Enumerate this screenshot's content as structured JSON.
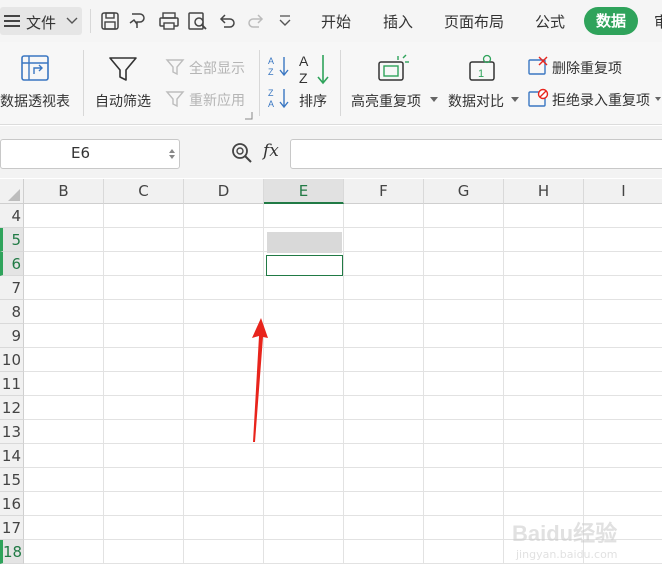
{
  "menu": {
    "file_label": "文件"
  },
  "tabs": [
    {
      "label": "开始"
    },
    {
      "label": "插入"
    },
    {
      "label": "页面布局"
    },
    {
      "label": "公式"
    },
    {
      "label": "数据",
      "active": true
    }
  ],
  "ribbon": {
    "pivot_label": "数据透视表",
    "autofilter_label": "自动筛选",
    "show_all_label": "全部显示",
    "reapply_label": "重新应用",
    "sort_label": "排序",
    "highlight_dup_label": "高亮重复项",
    "compare_label": "数据对比",
    "remove_dup_label": "删除重复项",
    "reject_dup_label": "拒绝录入重复项"
  },
  "formula_bar": {
    "name_box": "E6",
    "fx_label": "fx",
    "formula": ""
  },
  "sheet": {
    "columns": [
      "B",
      "C",
      "D",
      "E",
      "F",
      "G",
      "H",
      "I"
    ],
    "rows": [
      "4",
      "5",
      "6",
      "7",
      "8",
      "9",
      "10",
      "11",
      "12",
      "13",
      "14",
      "15",
      "16",
      "17",
      "18"
    ],
    "selected_column": "E",
    "selected_rows": [
      "5",
      "6",
      "18"
    ],
    "active_cell": "E6"
  },
  "watermark": {
    "text": "Baidu经验",
    "sub": "jingyan.baidu.com"
  },
  "colors": {
    "accent": "#2fa35b",
    "arrow": "#e8241c"
  }
}
